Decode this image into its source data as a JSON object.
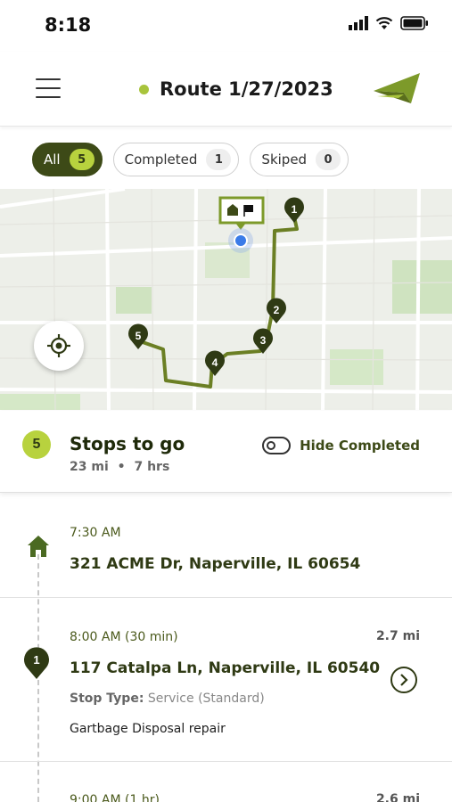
{
  "status_bar": {
    "time": "8:18"
  },
  "header": {
    "title": "Route 1/27/2023",
    "status_color": "#a8c43c"
  },
  "filters": [
    {
      "label": "All",
      "count": "5",
      "active": true
    },
    {
      "label": "Completed",
      "count": "1",
      "active": false
    },
    {
      "label": "Skiped",
      "count": "0",
      "active": false
    }
  ],
  "map": {
    "stop_markers": [
      "1",
      "2",
      "3",
      "4",
      "5"
    ],
    "route_color": "#6b7f24",
    "marker_color": "#2f3a14"
  },
  "summary": {
    "count": "5",
    "title": "Stops to go",
    "distance": "23 mi",
    "duration": "7 hrs",
    "separator": "•",
    "toggle_label": "Hide Completed"
  },
  "stops": [
    {
      "time": "7:30 AM",
      "address": "321 ACME Dr, Naperville, IL 60654",
      "icon": "home-icon"
    },
    {
      "number": "1",
      "time": "8:00 AM (30 min)",
      "distance": "2.7 mi",
      "address": "117 Catalpa Ln, Naperville, IL 60540",
      "type_label": "Stop Type:",
      "type_value": "Service (Standard)",
      "note": "Gartbage Disposal repair"
    },
    {
      "time": "9:00 AM (1 hr)",
      "distance": "2.6 mi"
    }
  ],
  "colors": {
    "brand_dark": "#3d4a17",
    "brand_light": "#b8d23e"
  }
}
